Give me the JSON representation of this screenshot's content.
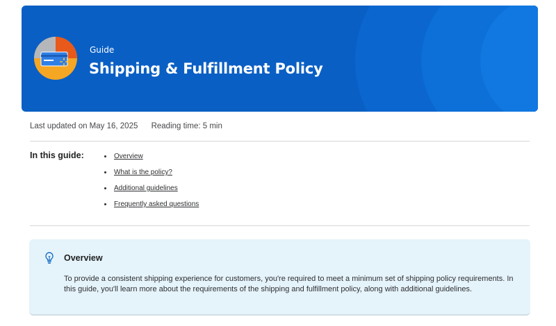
{
  "hero": {
    "eyebrow": "Guide",
    "title": "Shipping & Fulfillment Policy",
    "icon": "shipping-card-icon",
    "background_color": "#0a5fc4"
  },
  "meta": {
    "last_updated": "Last updated on May 16, 2025",
    "reading_time": "Reading time: 5 min"
  },
  "toc": {
    "label": "In this guide:",
    "items": [
      {
        "label": "Overview"
      },
      {
        "label": "What is the policy?"
      },
      {
        "label": "Additional guidelines"
      },
      {
        "label": "Frequently asked questions"
      }
    ]
  },
  "overview": {
    "icon": "lightbulb-icon",
    "title": "Overview",
    "body": "To provide a consistent shipping experience for customers, you're required to meet a minimum set of shipping policy requirements. In this guide, you'll learn more about the requirements of the shipping and fulfillment policy, along with additional guidelines.",
    "background_color": "#e5f3fa"
  }
}
